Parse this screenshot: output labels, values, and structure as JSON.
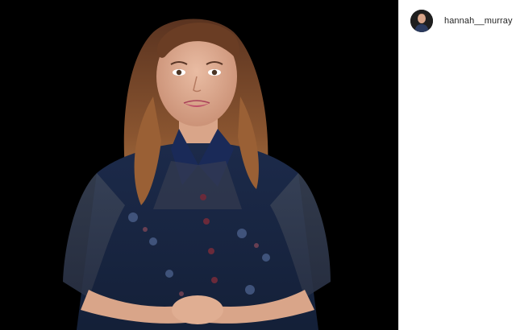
{
  "post": {
    "username": "hannah__murray"
  },
  "icons": {
    "avatar": "profile-avatar"
  },
  "colors": {
    "photo_background": "#000000",
    "panel_background": "#ffffff",
    "username_text": "#262626"
  }
}
